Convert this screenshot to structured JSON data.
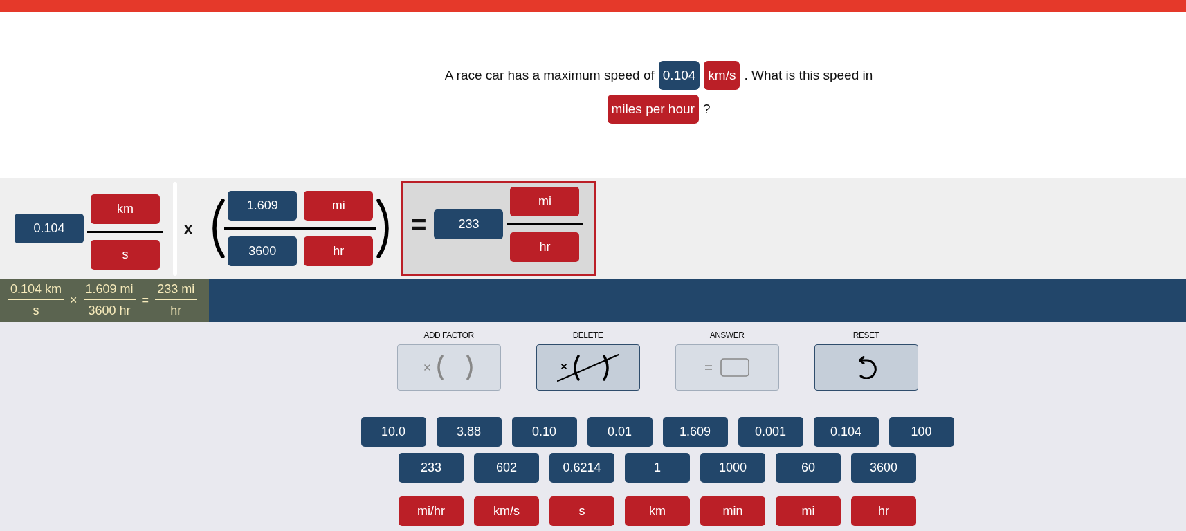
{
  "question": {
    "lines": [
      [
        {
          "kind": "text",
          "text": "A race car has a maximum speed of"
        },
        {
          "kind": "number",
          "text": "0.104"
        },
        {
          "kind": "unit",
          "text": "km/s"
        },
        {
          "kind": "text",
          "text": ". What is this speed in"
        }
      ],
      [
        {
          "kind": "unit",
          "text": "miles per hour"
        },
        {
          "kind": "text",
          "text": "?"
        }
      ]
    ]
  },
  "workspace": {
    "given": {
      "value": "0.104",
      "numerator": "km",
      "denominator": "s"
    },
    "factors": [
      {
        "operator": "x",
        "numerator": {
          "value": "1.609",
          "unit": "mi"
        },
        "denominator": {
          "value": "3600",
          "unit": "hr"
        }
      }
    ],
    "answer": {
      "operator": "=",
      "value": "233",
      "numerator": "mi",
      "denominator": "hr"
    }
  },
  "summary_bar": {
    "terms": [
      {
        "numerator": "0.104 km",
        "denominator": "s"
      },
      {
        "operator": "×",
        "numerator": "1.609 mi",
        "denominator": "3600 hr"
      },
      {
        "operator": "=",
        "numerator": "233 mi",
        "denominator": "hr"
      }
    ]
  },
  "tools": [
    {
      "kind": "add_factor",
      "label": "ADD FACTOR",
      "disabled": true
    },
    {
      "kind": "delete",
      "label": "DELETE",
      "disabled": false
    },
    {
      "kind": "answer",
      "label": "ANSWER",
      "disabled": true
    },
    {
      "kind": "reset",
      "label": "RESET",
      "disabled": false
    }
  ],
  "number_tiles": [
    "10.0",
    "3.88",
    "0.10",
    "0.01",
    "1.609",
    "0.001",
    "0.104",
    "100",
    "233",
    "602",
    "0.6214",
    "1",
    "1000",
    "60",
    "3600"
  ],
  "unit_tiles": [
    "mi/hr",
    "km/s",
    "s",
    "km",
    "min",
    "mi",
    "hr"
  ]
}
